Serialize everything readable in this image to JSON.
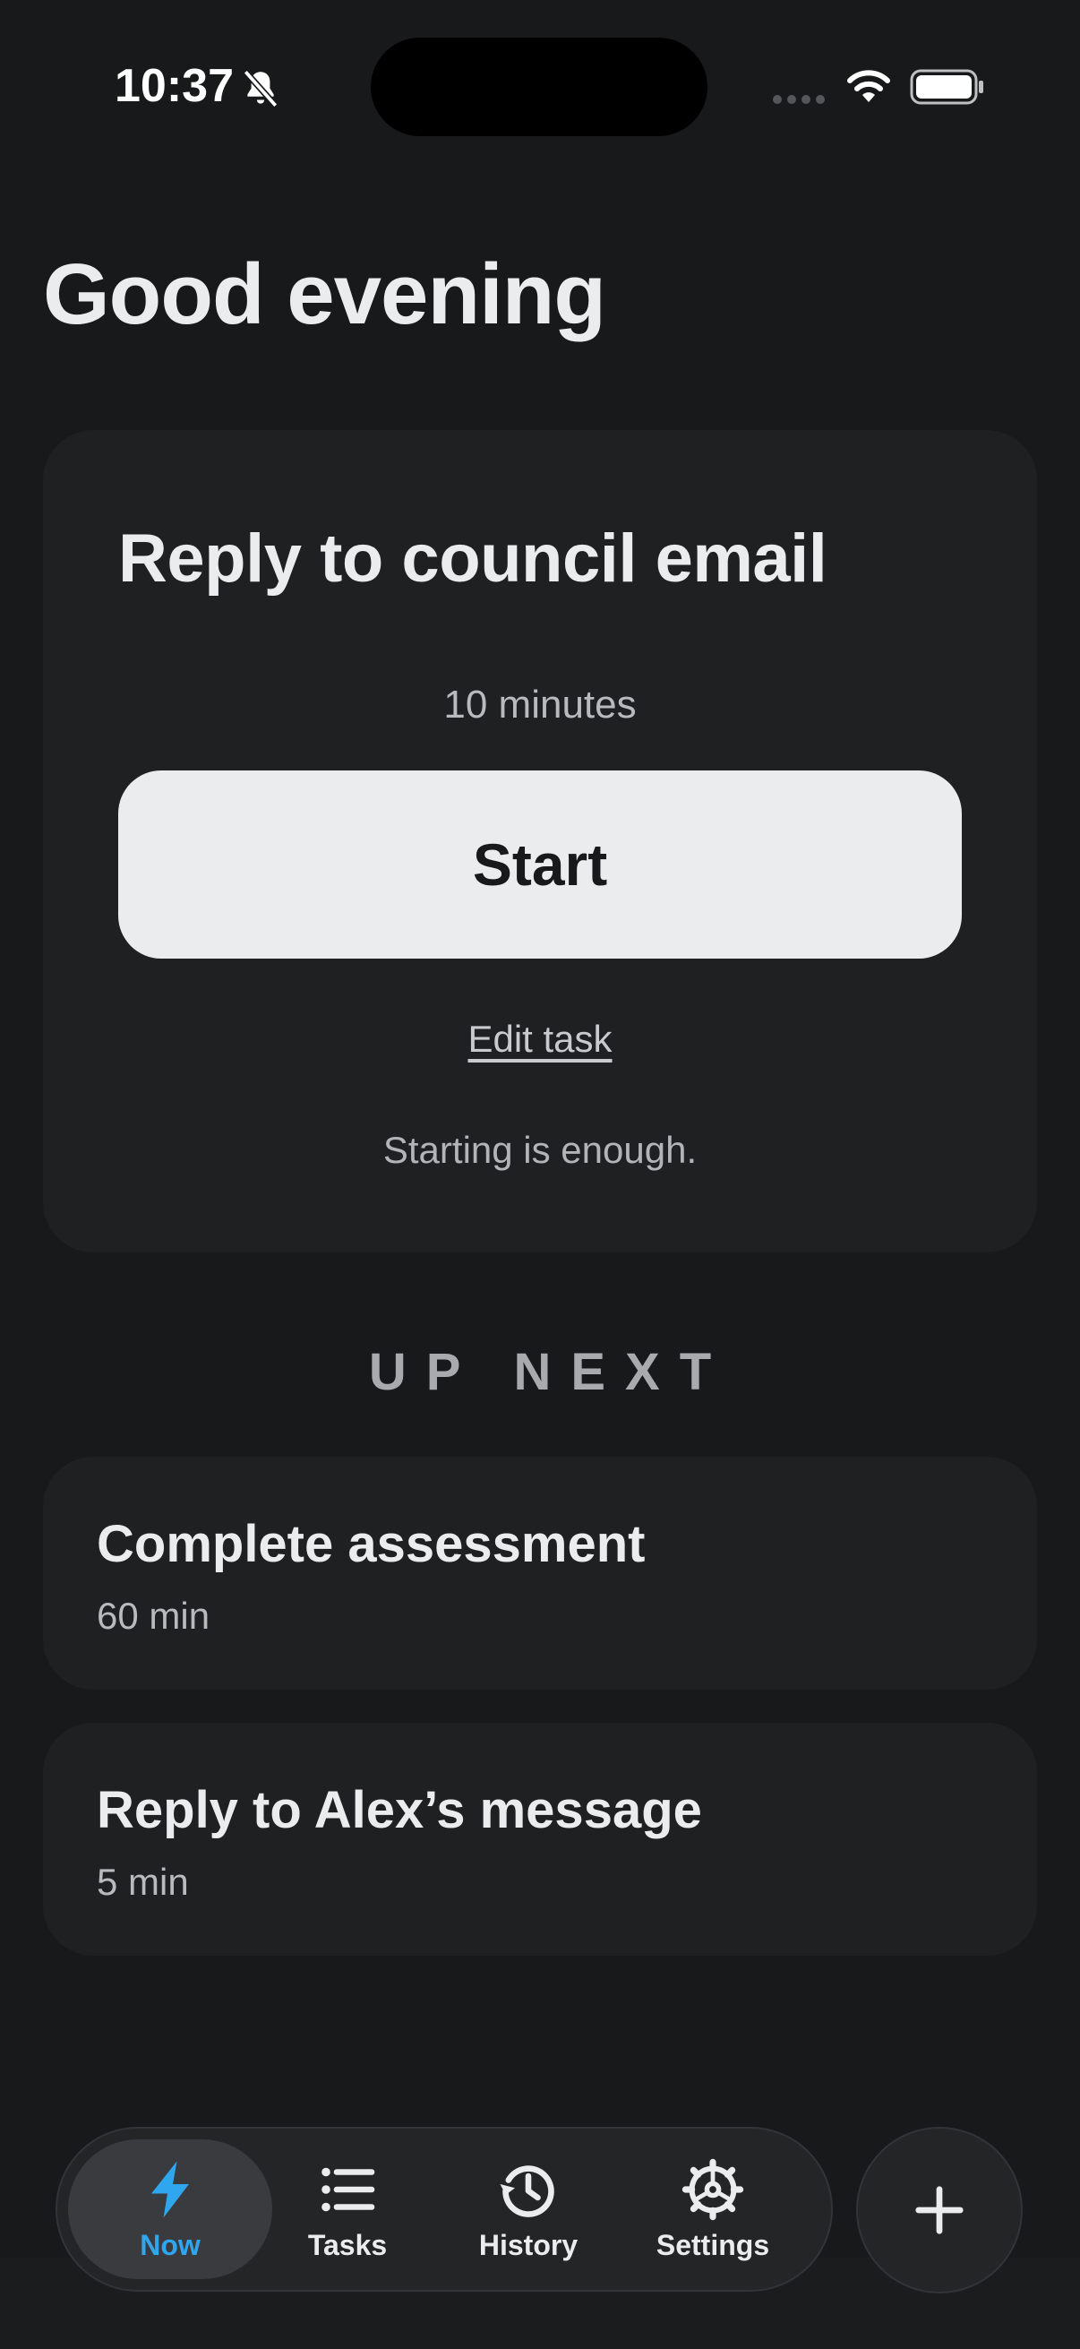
{
  "status_bar": {
    "time": "10:37",
    "icons": [
      "bell-slash-icon",
      "signal-icon",
      "wifi-icon",
      "battery-icon"
    ]
  },
  "greeting": "Good evening",
  "current_task": {
    "title": "Reply to council email",
    "duration": "10 minutes",
    "start_label": "Start",
    "edit_label": "Edit task",
    "encouragement": "Starting is enough."
  },
  "up_next": {
    "heading": "UP NEXT",
    "items": [
      {
        "title": "Complete assessment",
        "duration": "60 min"
      },
      {
        "title": "Reply to Alex’s message",
        "duration": "5 min"
      }
    ]
  },
  "tab_bar": {
    "tabs": [
      {
        "label": "Now",
        "icon": "bolt-icon",
        "active": true
      },
      {
        "label": "Tasks",
        "icon": "list-icon",
        "active": false
      },
      {
        "label": "History",
        "icon": "history-icon",
        "active": false
      },
      {
        "label": "Settings",
        "icon": "gear-icon",
        "active": false
      }
    ],
    "add_icon": "plus-icon"
  },
  "colors": {
    "background": "#18191b",
    "card": "#1f2022",
    "accent": "#2fa6ee",
    "button": "#ebecee"
  }
}
